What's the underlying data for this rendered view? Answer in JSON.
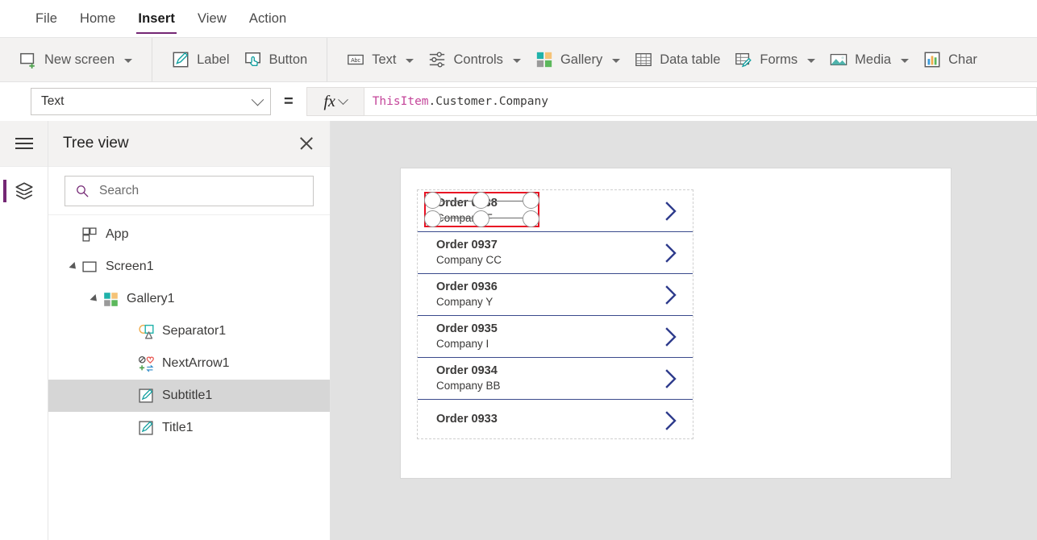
{
  "menu": {
    "items": [
      {
        "label": "File",
        "active": false
      },
      {
        "label": "Home",
        "active": false
      },
      {
        "label": "Insert",
        "active": true
      },
      {
        "label": "View",
        "active": false
      },
      {
        "label": "Action",
        "active": false
      }
    ]
  },
  "ribbon": {
    "groups": [
      {
        "buttons": [
          {
            "label": "New screen",
            "icon": "new-screen-icon",
            "caret": true
          }
        ]
      },
      {
        "buttons": [
          {
            "label": "Label",
            "icon": "label-icon",
            "caret": false
          },
          {
            "label": "Button",
            "icon": "button-icon",
            "caret": false
          }
        ]
      },
      {
        "buttons": [
          {
            "label": "Text",
            "icon": "text-icon",
            "caret": true
          },
          {
            "label": "Controls",
            "icon": "controls-icon",
            "caret": true
          },
          {
            "label": "Gallery",
            "icon": "gallery-icon",
            "caret": true
          },
          {
            "label": "Data table",
            "icon": "data-table-icon",
            "caret": false
          },
          {
            "label": "Forms",
            "icon": "forms-icon",
            "caret": true
          },
          {
            "label": "Media",
            "icon": "media-icon",
            "caret": true
          },
          {
            "label": "Char",
            "icon": "charts-icon",
            "caret": false
          }
        ]
      }
    ]
  },
  "formula_bar": {
    "property_selected": "Text",
    "equals": "=",
    "fx_label": "fx",
    "formula_token_1": "ThisItem",
    "formula_token_2": ".Customer.Company"
  },
  "rail": {
    "hamburger": "hamburger-menu",
    "items": [
      {
        "name": "tree-view-layers",
        "selected": true
      }
    ]
  },
  "tree_view": {
    "title": "Tree view",
    "search_placeholder": "Search",
    "search_value": "",
    "nodes": [
      {
        "label": "App",
        "icon": "app-icon",
        "indent": 0,
        "expander": "none",
        "selected": false
      },
      {
        "label": "Screen1",
        "icon": "screen-icon",
        "indent": 0,
        "expander": "expanded",
        "selected": false
      },
      {
        "label": "Gallery1",
        "icon": "gallery-icon",
        "indent": 1,
        "expander": "expanded",
        "selected": false
      },
      {
        "label": "Separator1",
        "icon": "shapes-icon",
        "indent": 2,
        "expander": "none",
        "selected": false
      },
      {
        "label": "NextArrow1",
        "icon": "icons-icon",
        "indent": 2,
        "expander": "none",
        "selected": false
      },
      {
        "label": "Subtitle1",
        "icon": "label-icon",
        "indent": 2,
        "expander": "none",
        "selected": true
      },
      {
        "label": "Title1",
        "icon": "label-icon",
        "indent": 2,
        "expander": "none",
        "selected": false
      }
    ]
  },
  "canvas": {
    "gallery_items": [
      {
        "title": "Order 0938",
        "subtitle": "Company F",
        "selected": true,
        "clipped": false
      },
      {
        "title": "Order 0937",
        "subtitle": "Company CC",
        "selected": false,
        "clipped": false
      },
      {
        "title": "Order 0936",
        "subtitle": "Company Y",
        "selected": false,
        "clipped": false
      },
      {
        "title": "Order 0935",
        "subtitle": "Company I",
        "selected": false,
        "clipped": false
      },
      {
        "title": "Order 0934",
        "subtitle": "Company BB",
        "selected": false,
        "clipped": false
      },
      {
        "title": "Order 0933",
        "subtitle": "",
        "selected": false,
        "clipped": true
      }
    ]
  },
  "colors": {
    "accent_purple": "#742774",
    "selection_red": "#e81123",
    "chevron_navy": "#2e3b8c",
    "ribbon_bg": "#f3f2f1",
    "canvas_bg": "#e1e1e1",
    "tree_selected_bg": "#d6d6d6"
  }
}
